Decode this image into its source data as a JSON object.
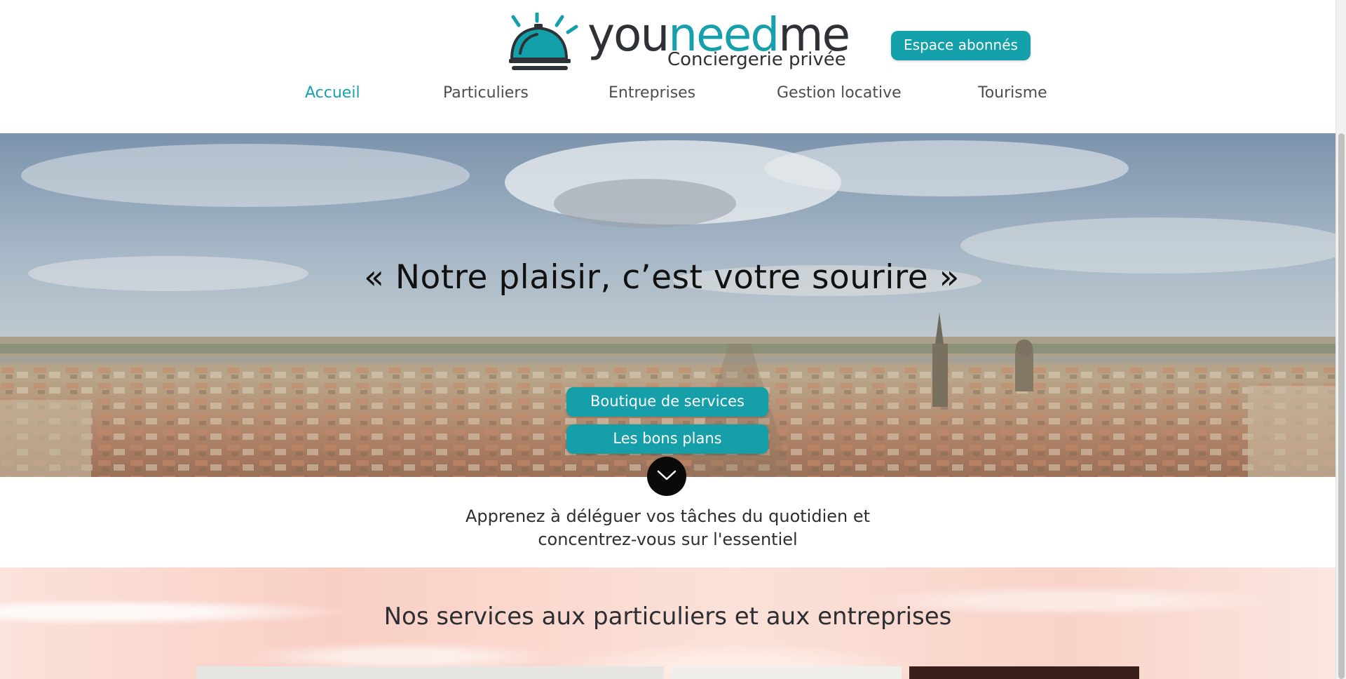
{
  "header": {
    "logo": {
      "word_part1": "you",
      "word_part2": "need",
      "word_part3": "me",
      "subtitle": "Conciergerie privée"
    },
    "subscribers_button": "Espace abonnés"
  },
  "nav": {
    "items": [
      {
        "label": "Accueil",
        "active": true
      },
      {
        "label": "Particuliers",
        "active": false
      },
      {
        "label": "Entreprises",
        "active": false
      },
      {
        "label": "Gestion locative",
        "active": false
      },
      {
        "label": "Tourisme",
        "active": false
      }
    ]
  },
  "hero": {
    "quote": "« Notre plaisir, c’est votre sourire »",
    "buttons": [
      "Boutique de services",
      "Les bons plans"
    ],
    "scroll_icon": "chevron-down-icon"
  },
  "tagline": {
    "line1": "Apprenez à déléguer vos tâches du quotidien et",
    "line2": "concentrez-vous sur l'essentiel"
  },
  "services": {
    "title": "Nos services aux particuliers et aux entreprises"
  },
  "colors": {
    "accent": "#14a0aa",
    "text_dark": "#2e3136"
  }
}
